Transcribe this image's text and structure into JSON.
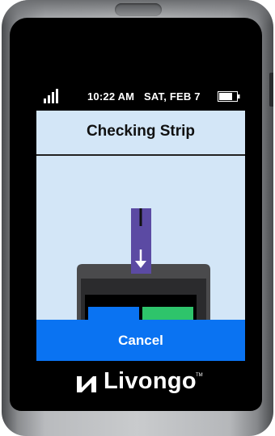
{
  "status_bar": {
    "time": "10:22 AM",
    "date": "SAT, FEB 7",
    "signal_icon": "signal-bars-icon",
    "battery_icon": "battery-icon"
  },
  "screen": {
    "title": "Checking Strip",
    "illustration": "test-strip-inserting-into-meter",
    "cancel_label": "Cancel"
  },
  "brand": {
    "name": "Livongo",
    "trademark": "TM"
  },
  "colors": {
    "screen_background": "#d3e6f7",
    "cancel_button": "#0a73f2",
    "strip": "#5b4aa3",
    "meter_blue": "#0a73f2",
    "meter_green": "#2ec46b"
  }
}
